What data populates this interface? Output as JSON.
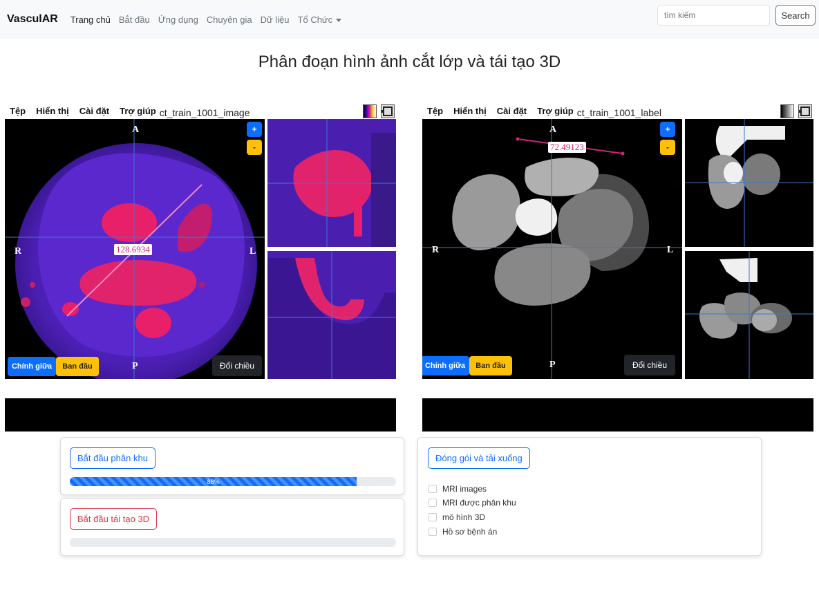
{
  "navbar": {
    "brand": "VasculAR",
    "links": [
      "Trang chủ",
      "Bắt đầu",
      "Ứng dụng",
      "Chuyên gia",
      "Dữ liệu",
      "Tổ Chức"
    ],
    "search_placeholder": "tìm kiếm",
    "search_button": "Search"
  },
  "page": {
    "title": "Phân đoạn hình ảnh cắt lớp và tái tạo 3D"
  },
  "viewer_left": {
    "menu": [
      "Tệp",
      "Hiển thị",
      "Cài đặt",
      "Trợ giúp"
    ],
    "file_name": "ct_train_1001_image",
    "orientation": {
      "top": "A",
      "left": "R",
      "right": "L",
      "bottom": "P"
    },
    "measurement": "128.6934",
    "zoom_in": "+",
    "zoom_out": "-",
    "center_button": "Chính giữa",
    "reset_button": "Ban đầu",
    "flip_button": "Đổi chiều"
  },
  "viewer_right": {
    "menu": [
      "Tệp",
      "Hiển thị",
      "Cài đặt",
      "Trợ giúp"
    ],
    "file_name": "ct_train_1001_label",
    "orientation": {
      "top": "A",
      "left": "R",
      "right": "L",
      "bottom": "P"
    },
    "measurement": "72.49123",
    "zoom_in": "+",
    "zoom_out": "-",
    "center_button": "Chính giữa",
    "reset_button": "Ban đầu",
    "flip_button": "Đổi chiều"
  },
  "segmentation": {
    "button": "Bắt đầu phân khu",
    "progress_label": "88%",
    "progress_value": 88
  },
  "reconstruction": {
    "button": "Bắt đầu tái tạo 3D",
    "progress_value": 0
  },
  "download": {
    "button": "Đóng gói và tải xuống",
    "options": [
      "MRI images",
      "MRI được phân khu",
      "mô hình 3D",
      "Hồ sơ bệnh án"
    ]
  },
  "colors": {
    "primary": "#0d6efd",
    "warning": "#ffc107",
    "danger": "#dc3545",
    "dark": "#212529",
    "measure": "#d0257b",
    "crosshair": "#3a78d8"
  }
}
